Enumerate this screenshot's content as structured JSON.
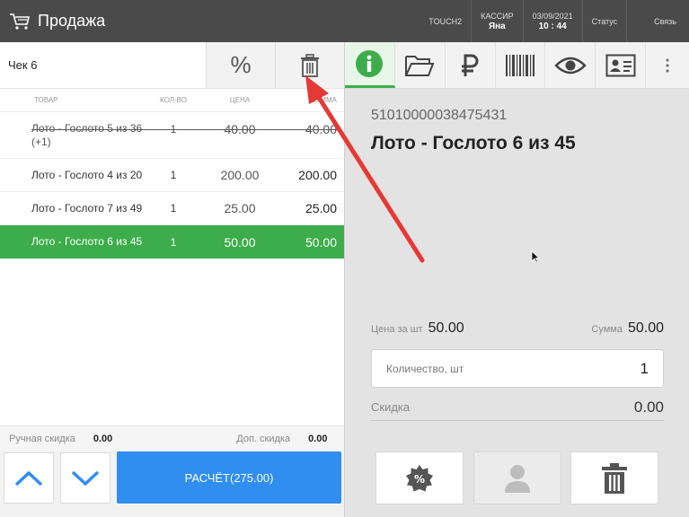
{
  "header": {
    "title": "Продажа",
    "terminal": "TOUCH2",
    "cashier_label": "КАССИР",
    "cashier_name": "Яна",
    "date": "03/09/2021",
    "time": "10 : 44",
    "status": "Статус",
    "connection": "Связь"
  },
  "receipt": {
    "label": "Чек 6",
    "discount_symbol": "%"
  },
  "table": {
    "headers": {
      "name": "ТОВАР",
      "qty": "КОЛ-ВО",
      "price": "ЦЕНА",
      "sum": "СУММА"
    },
    "rows": [
      {
        "name": "Лото - Гослото 5 из 36 (+1)",
        "qty": "1",
        "price": "40.00",
        "sum": "40.00",
        "state": "struck"
      },
      {
        "name": "Лото - Гослото 4 из 20",
        "qty": "1",
        "price": "200.00",
        "sum": "200.00",
        "state": "normal"
      },
      {
        "name": "Лото - Гослото 7 из 49",
        "qty": "1",
        "price": "25.00",
        "sum": "25.00",
        "state": "normal"
      },
      {
        "name": "Лото - Гослото 6 из 45",
        "qty": "1",
        "price": "50.00",
        "sum": "50.00",
        "state": "selected"
      }
    ]
  },
  "footer": {
    "manual_discount_label": "Ручная скидка",
    "manual_discount_value": "0.00",
    "extra_discount_label": "Доп. скидка",
    "extra_discount_value": "0.00",
    "pay_label": "РАСЧЁТ(275.00)"
  },
  "detail": {
    "barcode": "51010000038475431",
    "product_name": "Лото - Гослото 6 из 45",
    "unit_price_label": "Цена за шт",
    "unit_price": "50.00",
    "sum_label": "Сумма",
    "sum": "50.00",
    "qty_placeholder": "Количество, шт",
    "qty_value": "1",
    "discount_label": "Скидка",
    "discount_value": "0.00"
  },
  "colors": {
    "accent_green": "#3cad4a",
    "pay_blue": "#2f8ef0",
    "header_bg": "#4a4a4a",
    "annotation_red": "#e53935"
  }
}
